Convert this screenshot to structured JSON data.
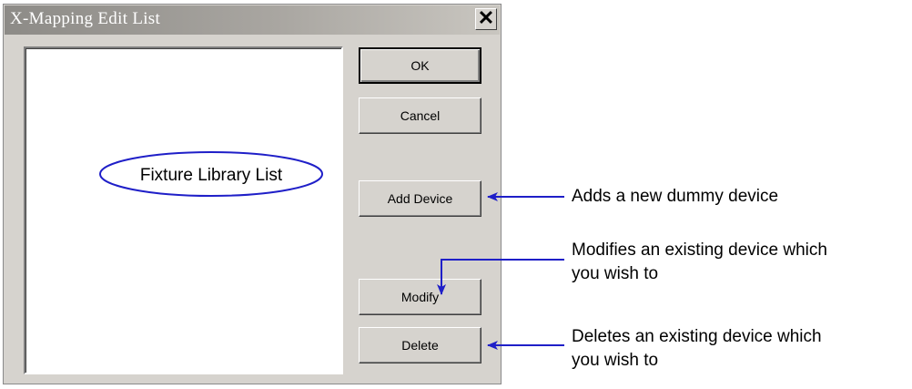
{
  "dialog": {
    "title": "X-Mapping Edit List",
    "close_label": "✕",
    "buttons": {
      "ok": "OK",
      "cancel": "Cancel",
      "add_device": "Add Device",
      "modify": "Modify",
      "delete": "Delete"
    }
  },
  "callouts": {
    "list_label": "Fixture Library List",
    "add_device": "Adds a new dummy device",
    "modify_line1": "Modifies an existing device which",
    "modify_line2": "you wish to",
    "delete_line1": "Deletes an existing device which",
    "delete_line2": "you wish to"
  },
  "colors": {
    "annotation": "#1f1fc8",
    "dialog_face": "#d6d3ce"
  }
}
